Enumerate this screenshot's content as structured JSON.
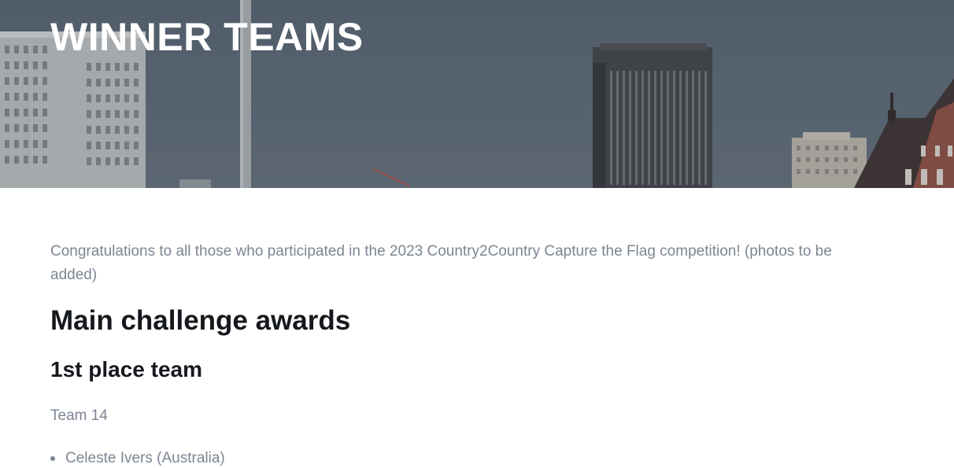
{
  "hero": {
    "title": "WINNER TEAMS"
  },
  "content": {
    "intro": "Congratulations to all those who participated in the 2023 Country2Country Capture the Flag competition! (photos to be added)",
    "section_heading": "Main challenge awards",
    "first_place": {
      "heading": "1st place team",
      "team_name": "Team 14",
      "members": [
        "Celeste Ivers (Australia)"
      ]
    }
  },
  "colors": {
    "hero_overlay": "#535f6c",
    "heading": "#15181c",
    "body_text": "#7c8693"
  }
}
